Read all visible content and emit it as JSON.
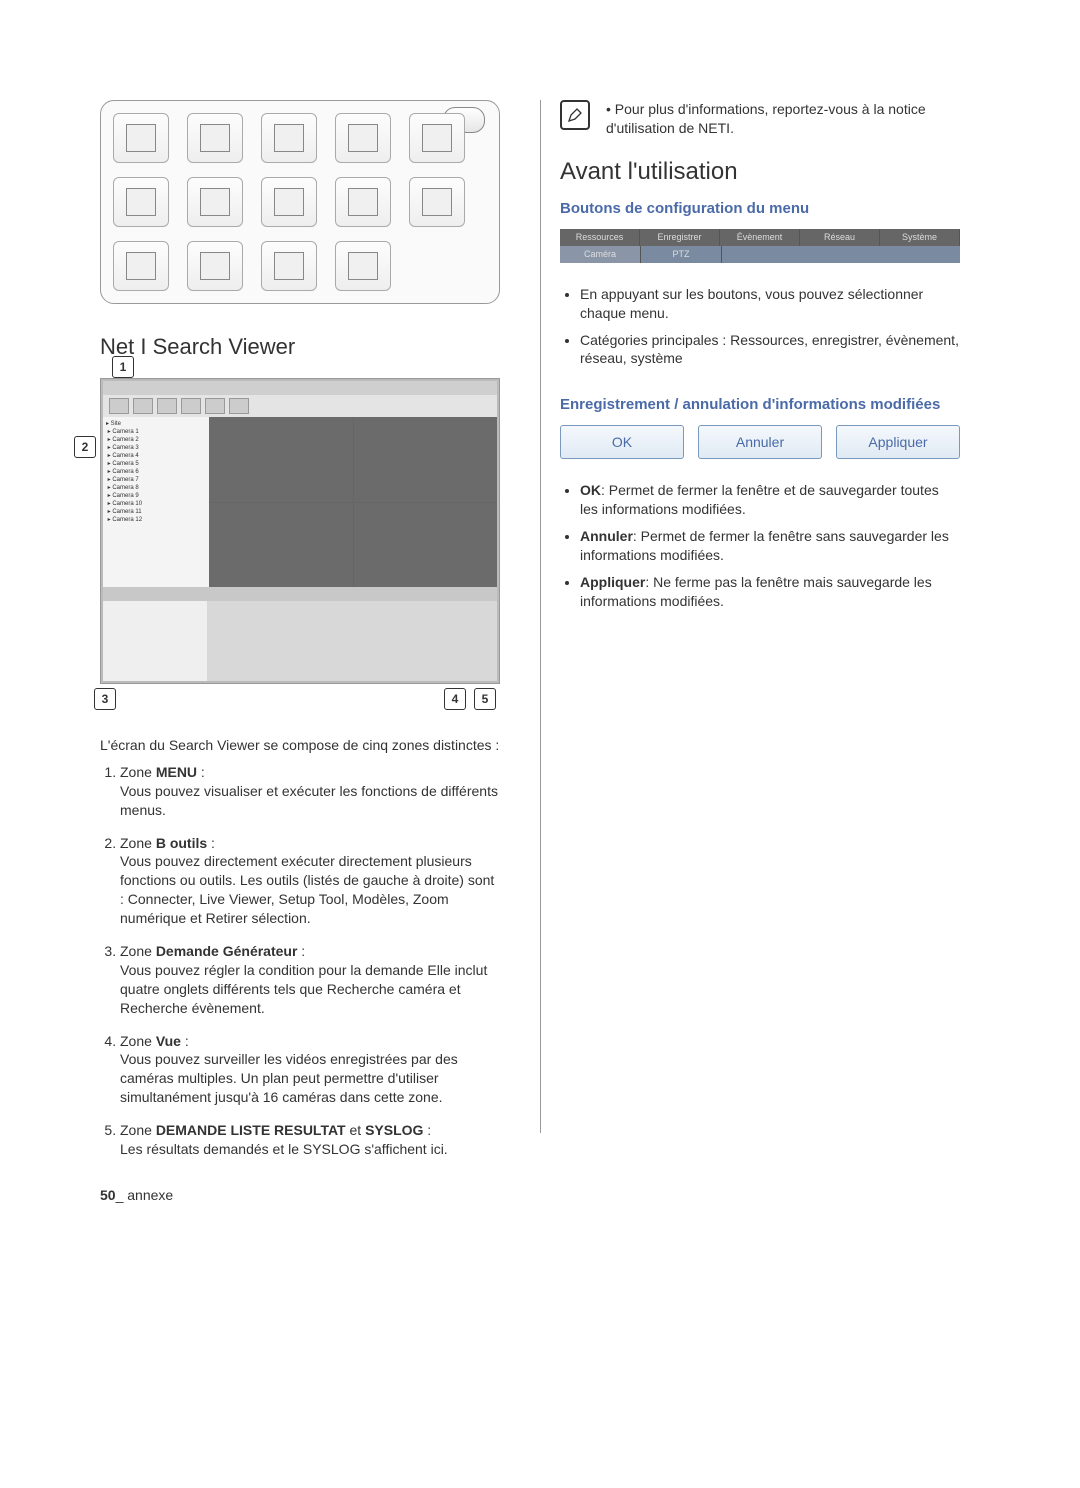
{
  "left": {
    "viewer_heading": "Net I Search Viewer",
    "callouts": {
      "c1": "1",
      "c2": "2",
      "c3": "3",
      "c4": "4",
      "c5": "5"
    },
    "intro": "L'écran du Search Viewer se compose de cinq zones distinctes :",
    "zones": [
      {
        "prefix": "Zone",
        "name": "MENU",
        "suffix": " :",
        "body": "Vous pouvez visualiser et exécuter les fonctions de différents menus."
      },
      {
        "prefix": "Zone",
        "name": "B outils",
        "suffix": " :",
        "body": "Vous pouvez directement exécuter directement plusieurs fonctions ou outils. Les outils (listés de gauche à droite) sont : Connecter, Live Viewer, Setup Tool, Modèles, Zoom numérique et Retirer sélection."
      },
      {
        "prefix": "Zone",
        "name": "Demande Générateur",
        "suffix": " :",
        "body": "Vous pouvez régler la condition pour la demande Elle inclut quatre onglets différents tels que Recherche caméra et Recherche évènement."
      },
      {
        "prefix": "Zone",
        "name": "Vue",
        "suffix": " :",
        "body": "Vous pouvez surveiller les vidéos enregistrées par des caméras multiples. Un plan peut permettre d'utiliser simultanément jusqu'à 16 caméras dans cette zone."
      },
      {
        "prefix": "Zone",
        "name": "DEMANDE LISTE RESULTAT",
        "suffix": " et ",
        "name2": "SYSLOG",
        "suffix2": " :",
        "body": "Les résultats demandés et le SYSLOG s'affichent ici."
      }
    ]
  },
  "right": {
    "note_bullet": "•",
    "note": "Pour plus d'informations, reportez-vous à la notice d'utilisation de NETI.",
    "heading": "Avant l'utilisation",
    "sub1": "Boutons de configuration du menu",
    "tabs_top": [
      "Ressources",
      "Enregistrer",
      "Évènement",
      "Réseau",
      "Système"
    ],
    "tabs_bottom": [
      "Caméra",
      "PTZ"
    ],
    "bullets1": [
      "En appuyant sur les boutons, vous pouvez sélectionner chaque menu.",
      "Catégories principales :  Ressources, enregistrer, évènement, réseau, système"
    ],
    "sub2": "Enregistrement / annulation d'informations modifiées",
    "buttons": {
      "ok": "OK",
      "cancel": "Annuler",
      "apply": "Appliquer"
    },
    "bullets2": [
      {
        "strong": "OK",
        "rest": ": Permet de fermer la fenêtre et de sauvegarder toutes les informations modifiées."
      },
      {
        "strong": "Annuler",
        "rest": ": Permet de fermer la fenêtre sans sauvegarder les informations modifiées."
      },
      {
        "strong": "Appliquer",
        "rest": ": Ne ferme pas la fenêtre mais sauvegarde les informations modifiées."
      }
    ]
  },
  "footer": {
    "page": "50",
    "label": "_ annexe"
  }
}
